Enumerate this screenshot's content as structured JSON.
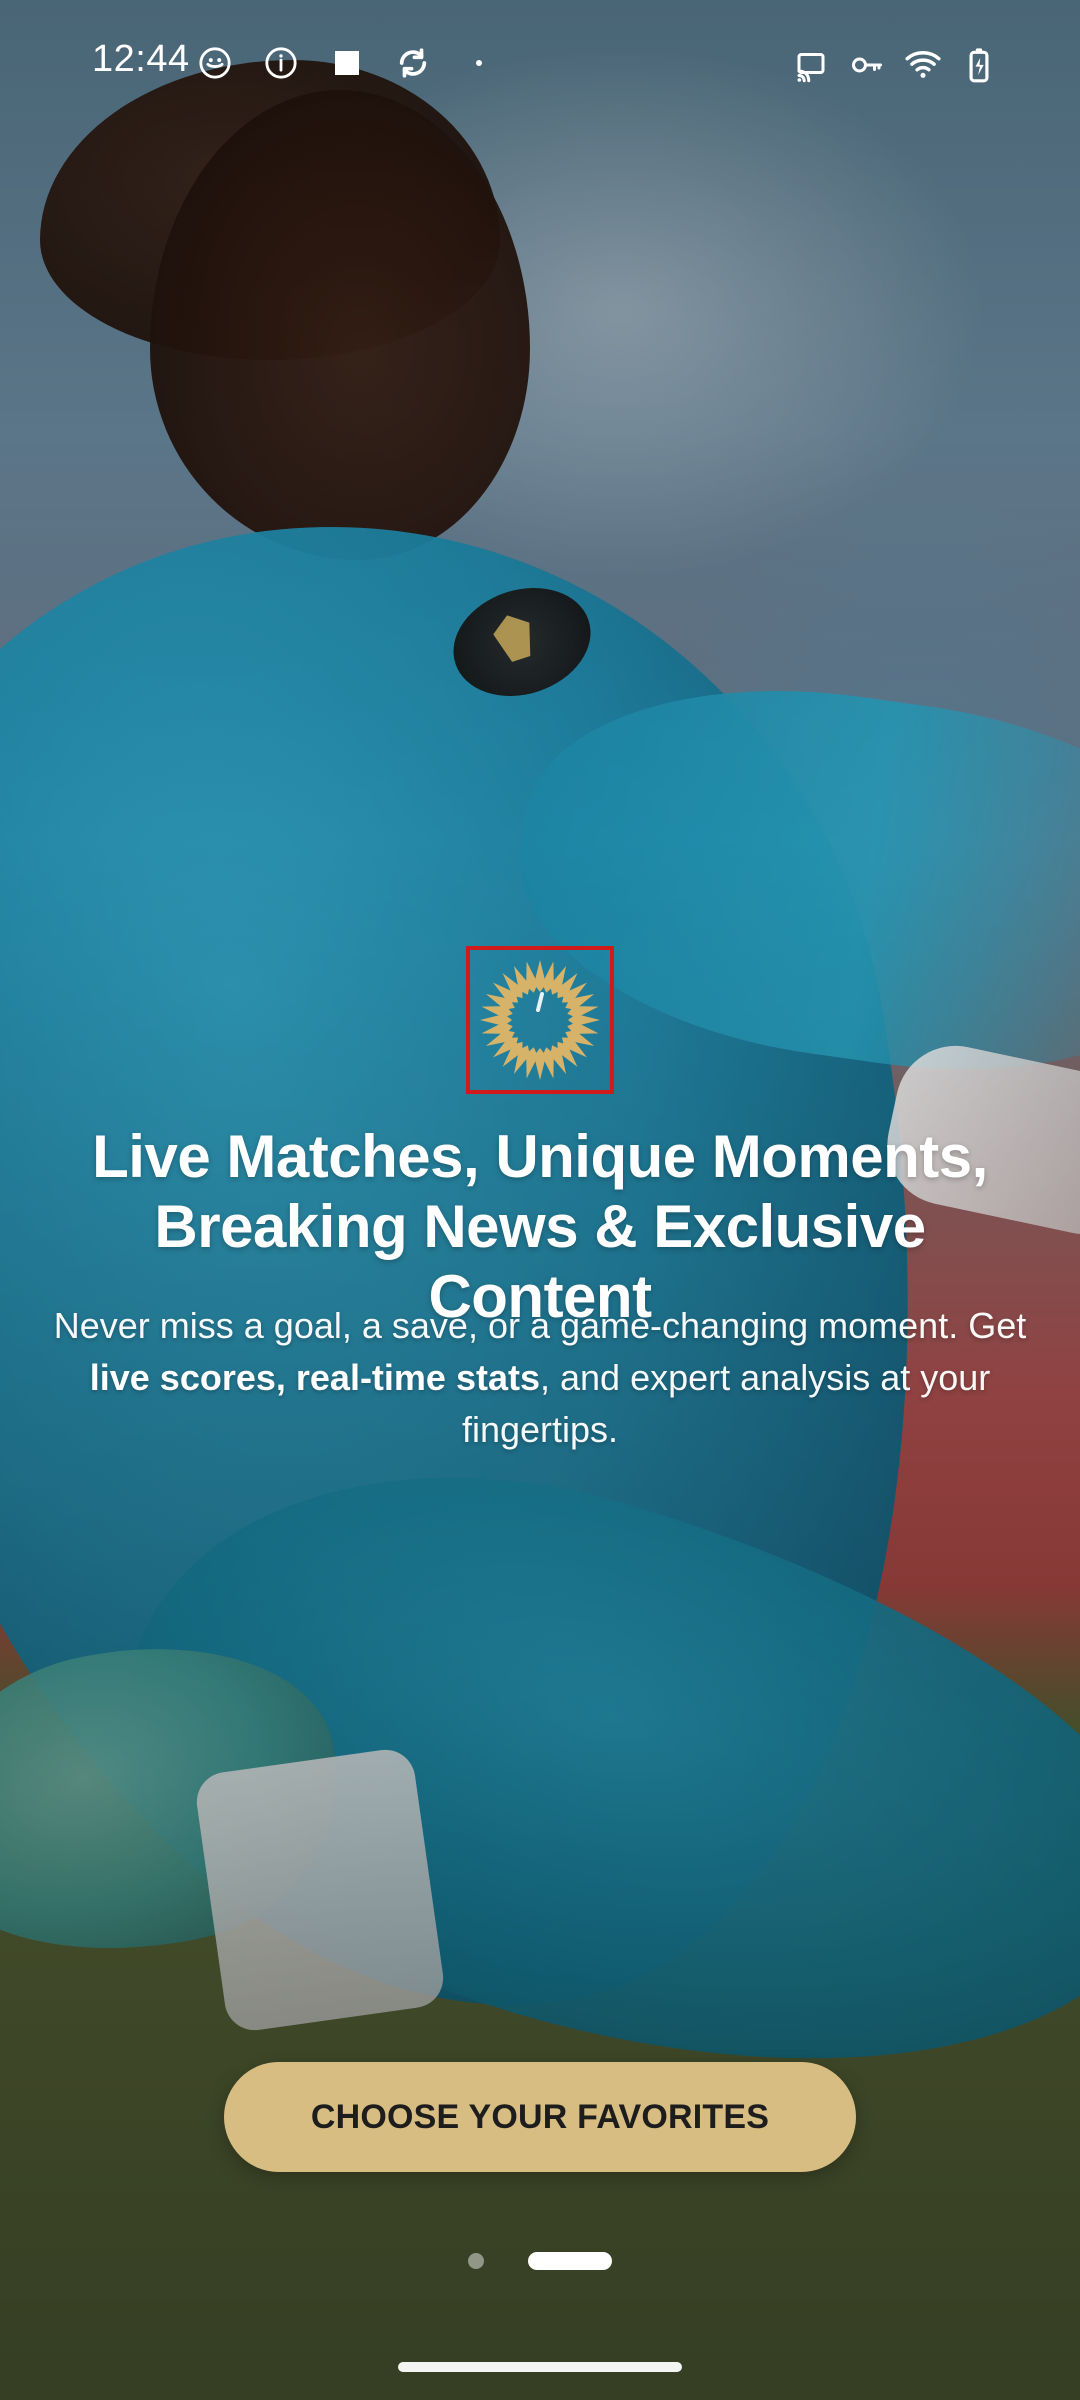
{
  "status_bar": {
    "time": "12:44",
    "left_icons": [
      "app-icon",
      "info-icon",
      "square-icon",
      "sync-icon",
      "dot-icon"
    ],
    "right_icons": [
      "cast-icon",
      "key-icon",
      "wifi-icon",
      "battery-charging-icon"
    ]
  },
  "onboarding": {
    "headline_line1": "Live Matches, Unique Moments,",
    "headline_line2": "Breaking News & Exclusive Content",
    "subtext_part1": "Never miss a goal, a save, or a game-changing moment. Get ",
    "subtext_bold": "live scores, real-time stats",
    "subtext_part2": ", and expert analysis at your fingertips.",
    "cta_label": "CHOOSE YOUR FAVORITES",
    "page_indicator": {
      "total": 2,
      "active_index": 1
    }
  },
  "colors": {
    "cta_bg": "#D8BD83",
    "cta_text": "#1D1D1D",
    "headline": "#FFFFFF",
    "subtext": "#FFFFFF",
    "highlight_box": "#D11B1B",
    "logo_gold": "#D7B36A"
  }
}
